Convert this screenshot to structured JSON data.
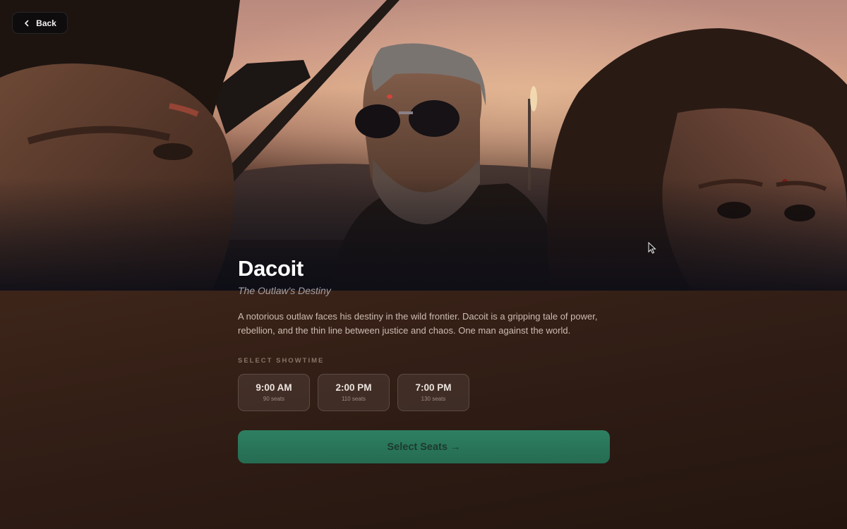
{
  "header": {
    "back_label": "Back"
  },
  "movie": {
    "title": "Dacoit",
    "tagline": "The Outlaw's Destiny",
    "description": "A notorious outlaw faces his destiny in the wild frontier. Dacoit is a gripping tale of power, rebellion, and the thin line between justice and chaos. One man against the world."
  },
  "showtime_section": {
    "label": "SELECT SHOWTIME",
    "options": [
      {
        "time": "9:00 AM",
        "seats": "90 seats"
      },
      {
        "time": "2:00 PM",
        "seats": "110 seats"
      },
      {
        "time": "7:00 PM",
        "seats": "130 seats"
      }
    ]
  },
  "cta": {
    "label": "Select Seats →"
  },
  "colors": {
    "background": "#3c2419",
    "accent_green": "#2e8062",
    "title": "#ffffff"
  },
  "icons": {
    "back": "chevron-left-icon",
    "pointer": "mouse-cursor-icon"
  }
}
